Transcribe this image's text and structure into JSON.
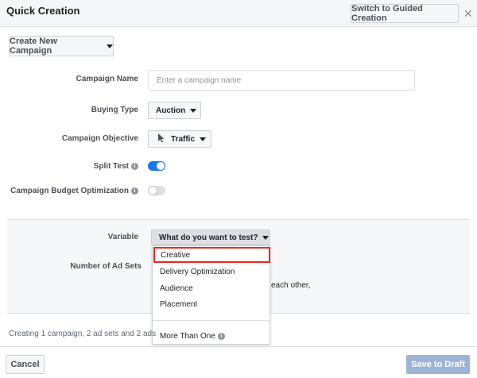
{
  "header": {
    "title": "Quick Creation",
    "guided_button": "Switch to Guided Creation",
    "close_glyph": "✕"
  },
  "campaign": {
    "create_button": "Create New Campaign",
    "name_label": "Campaign Name",
    "name_placeholder": "Enter a campaign name",
    "buying_type_label": "Buying Type",
    "buying_type_value": "Auction",
    "objective_label": "Campaign Objective",
    "objective_value": "Traffic",
    "split_test_label": "Split Test",
    "split_test_on": true,
    "budget_opt_label": "Campaign Budget Optimization",
    "budget_opt_on": false
  },
  "split_test": {
    "variable_label": "Variable",
    "variable_placeholder": "What do you want to test?",
    "ad_sets_label": "Number of Ad Sets",
    "helper_text_fragment": "each other,",
    "options": [
      {
        "label": "Creative",
        "highlighted": true
      },
      {
        "label": "Delivery Optimization",
        "highlighted": false
      },
      {
        "label": "Audience",
        "highlighted": false
      },
      {
        "label": "Placement",
        "highlighted": false
      }
    ],
    "more_option": "More Than One"
  },
  "footer": {
    "summary": "Creating 1 campaign, 2 ad sets and 2 ads",
    "cancel_button": "Cancel",
    "save_button": "Save to Draft"
  },
  "colors": {
    "accent": "#1877f2",
    "highlight_border": "#e8261f",
    "save_disabled": "#9cb4d8"
  },
  "icons": {
    "info": "info-icon",
    "cursor": "cursor-arrow-icon",
    "close": "close-icon"
  }
}
